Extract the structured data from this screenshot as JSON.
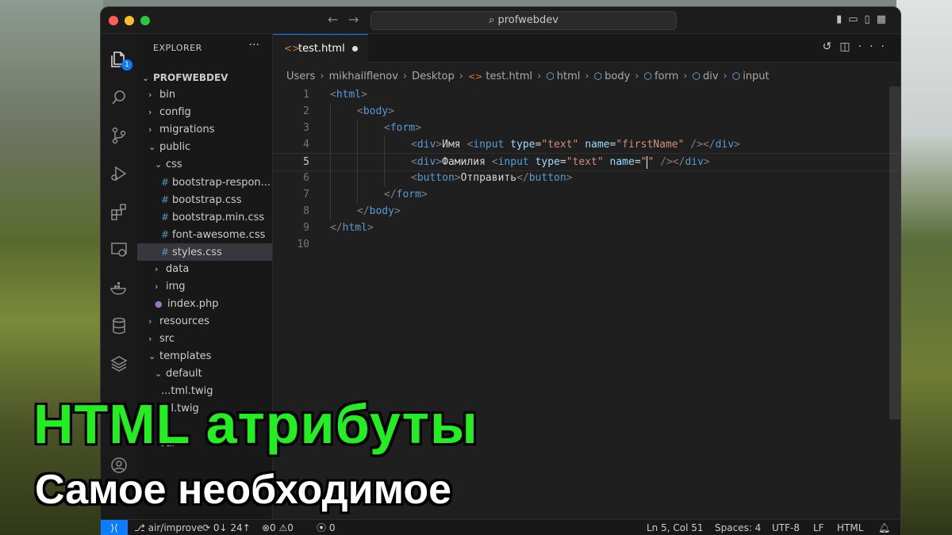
{
  "window": {
    "search_text": "profwebdev"
  },
  "sidebar": {
    "header": "EXPLORER",
    "project": "PROFWEBDEV",
    "tree": [
      {
        "label": "bin",
        "type": "folder",
        "depth": 1,
        "open": false
      },
      {
        "label": "config",
        "type": "folder",
        "depth": 1,
        "open": false
      },
      {
        "label": "migrations",
        "type": "folder",
        "depth": 1,
        "open": false
      },
      {
        "label": "public",
        "type": "folder",
        "depth": 1,
        "open": true
      },
      {
        "label": "css",
        "type": "folder",
        "depth": 2,
        "open": true
      },
      {
        "label": "bootstrap-respon...",
        "type": "css",
        "depth": 3
      },
      {
        "label": "bootstrap.css",
        "type": "css",
        "depth": 3
      },
      {
        "label": "bootstrap.min.css",
        "type": "css",
        "depth": 3
      },
      {
        "label": "font-awesome.css",
        "type": "css",
        "depth": 3
      },
      {
        "label": "styles.css",
        "type": "css",
        "depth": 3,
        "selected": true
      },
      {
        "label": "data",
        "type": "folder",
        "depth": 2,
        "open": false
      },
      {
        "label": "img",
        "type": "folder",
        "depth": 2,
        "open": false
      },
      {
        "label": "index.php",
        "type": "php",
        "depth": 2
      },
      {
        "label": "resources",
        "type": "folder",
        "depth": 1,
        "open": false
      },
      {
        "label": "src",
        "type": "folder",
        "depth": 1,
        "open": false
      },
      {
        "label": "templates",
        "type": "folder",
        "depth": 1,
        "open": true
      },
      {
        "label": "default",
        "type": "folder",
        "depth": 2,
        "open": true
      },
      {
        "label": "...tml.twig",
        "type": "twig",
        "depth": 3
      },
      {
        "label": "...l.twig",
        "type": "twig",
        "depth": 3
      },
      {
        "label": "",
        "type": "blank",
        "depth": 1
      },
      {
        "label": "var",
        "type": "folder",
        "depth": 1,
        "open": false
      }
    ]
  },
  "tab": {
    "label": "test.html"
  },
  "breadcrumb": [
    "Users",
    "mikhailflenov",
    "Desktop",
    "test.html",
    "html",
    "body",
    "form",
    "div",
    "input"
  ],
  "code": [
    {
      "n": "1",
      "html": "<span class=\"angle\">&lt;</span><span class=\"tag\">html</span><span class=\"angle\">&gt;</span>",
      "indent": 0
    },
    {
      "n": "2",
      "html": "<span class=\"angle\">&lt;</span><span class=\"tag\">body</span><span class=\"angle\">&gt;</span>",
      "indent": 1
    },
    {
      "n": "3",
      "html": "<span class=\"angle\">&lt;</span><span class=\"tag\">form</span><span class=\"angle\">&gt;</span>",
      "indent": 2
    },
    {
      "n": "4",
      "html": "<span class=\"angle\">&lt;</span><span class=\"tag\">div</span><span class=\"angle\">&gt;</span><span class=\"plain\">Имя </span><span class=\"angle\">&lt;</span><span class=\"tag\">input</span> <span class=\"attr\">type</span><span class=\"plain\">=</span><span class=\"str\">\"text\"</span> <span class=\"attr\">name</span><span class=\"plain\">=</span><span class=\"str\">\"firstName\"</span> <span class=\"angle\">/&gt;&lt;/</span><span class=\"tag\">div</span><span class=\"angle\">&gt;</span>",
      "indent": 3
    },
    {
      "n": "5",
      "html": "<span class=\"angle\">&lt;</span><span class=\"tag\">div</span><span class=\"angle\">&gt;</span><span class=\"plain\">Фамилия </span><span class=\"angle\">&lt;</span><span class=\"tag\">input</span> <span class=\"attr\">type</span><span class=\"plain\">=</span><span class=\"str\">\"text\"</span> <span class=\"attr\">name</span><span class=\"plain\">=</span><span class=\"str\">\"</span><span class=\"cursor\"></span><span class=\"str\">\"</span> <span class=\"angle\">/&gt;&lt;/</span><span class=\"tag\">div</span><span class=\"angle\">&gt;</span>",
      "indent": 3,
      "current": true
    },
    {
      "n": "6",
      "html": "<span class=\"angle\">&lt;</span><span class=\"tag\">button</span><span class=\"angle\">&gt;</span><span class=\"plain\">Отправить</span><span class=\"angle\">&lt;/</span><span class=\"tag\">button</span><span class=\"angle\">&gt;</span>",
      "indent": 3
    },
    {
      "n": "7",
      "html": "<span class=\"angle\">&lt;/</span><span class=\"tag\">form</span><span class=\"angle\">&gt;</span>",
      "indent": 2
    },
    {
      "n": "8",
      "html": "<span class=\"angle\">&lt;/</span><span class=\"tag\">body</span><span class=\"angle\">&gt;</span>",
      "indent": 1
    },
    {
      "n": "9",
      "html": "<span class=\"angle\">&lt;/</span><span class=\"tag\">html</span><span class=\"angle\">&gt;</span>",
      "indent": 0
    },
    {
      "n": "10",
      "html": "",
      "indent": 0
    }
  ],
  "status": {
    "branch": "air/improve",
    "sync": "0↓ 24↑",
    "problems": "⊗0 ⚠0",
    "ports": "0",
    "position": "Ln 5, Col 51",
    "spaces": "Spaces: 4",
    "encoding": "UTF-8",
    "eol": "LF",
    "language": "HTML"
  },
  "overlay": {
    "title": "HTML атрибуты",
    "subtitle": "Самое необходимое"
  },
  "colors": {
    "accent": "#0a7cff",
    "overlay_title": "#22ee22"
  }
}
